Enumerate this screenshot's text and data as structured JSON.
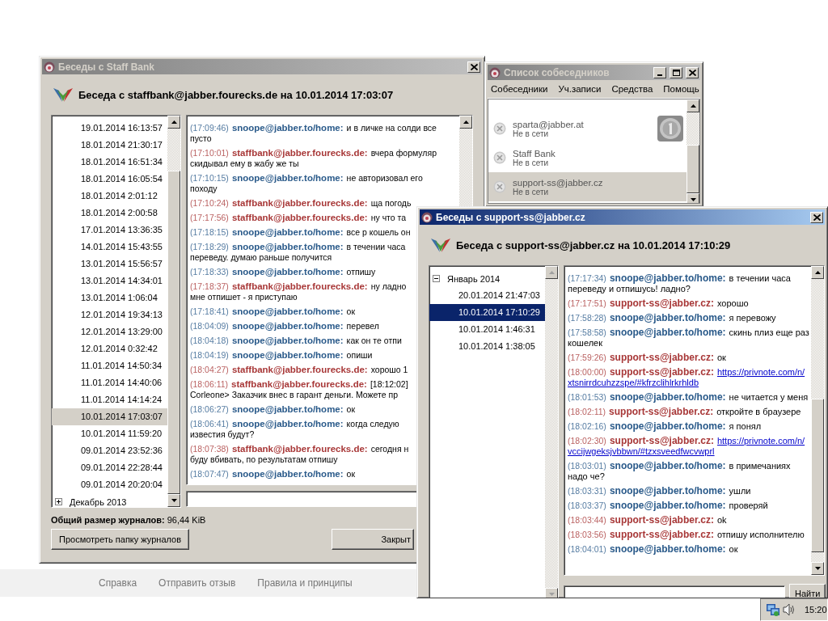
{
  "windows": [
    {
      "kind": "history",
      "title": "Беседы с Staff Bank",
      "active": false,
      "header": "Беседа с staffbank@jabber.fourecks.de на 10.01.2014 17:03:07",
      "tree": [
        {
          "children": [
            {
              "label": "19.01.2014 16:13:57",
              "selected": false
            },
            {
              "label": "18.01.2014 21:30:17",
              "selected": false
            },
            {
              "label": "18.01.2014 16:51:34",
              "selected": false
            },
            {
              "label": "18.01.2014 16:05:54",
              "selected": false
            },
            {
              "label": "18.01.2014 2:01:12",
              "selected": false
            },
            {
              "label": "18.01.2014 2:00:58",
              "selected": false
            },
            {
              "label": "17.01.2014 13:36:35",
              "selected": false
            },
            {
              "label": "14.01.2014 15:43:55",
              "selected": false
            },
            {
              "label": "13.01.2014 15:56:57",
              "selected": false
            },
            {
              "label": "13.01.2014 14:34:01",
              "selected": false
            },
            {
              "label": "13.01.2014 1:06:04",
              "selected": false
            },
            {
              "label": "12.01.2014 19:34:13",
              "selected": false
            },
            {
              "label": "12.01.2014 13:29:00",
              "selected": false
            },
            {
              "label": "12.01.2014 0:32:42",
              "selected": false
            },
            {
              "label": "11.01.2014 14:50:34",
              "selected": false
            },
            {
              "label": "11.01.2014 14:40:06",
              "selected": false
            },
            {
              "label": "11.01.2014 14:14:24",
              "selected": false
            },
            {
              "label": "10.01.2014 17:03:07",
              "selected": true
            },
            {
              "label": "10.01.2014 11:59:20",
              "selected": false
            },
            {
              "label": "09.01.2014 23:52:36",
              "selected": false
            },
            {
              "label": "09.01.2014 22:28:44",
              "selected": false
            },
            {
              "label": "09.01.2014 20:20:04",
              "selected": false
            }
          ]
        },
        {
          "label": "Декабрь 2013",
          "expanded": false
        }
      ],
      "messages": [
        {
          "time": "(17:09:46)",
          "sender": "snoope@jabber.to/home:",
          "color": "#2a5a8a",
          "kind": "text",
          "text": "и в личке на солди все",
          "line_2": "пусто"
        },
        {
          "time": "(17:10:01)",
          "sender": "staffbank@jabber.fourecks.de:",
          "color": "#a83838",
          "kind": "text",
          "text": "вчера формуляр",
          "line_2": "скидывал ему в жабу же ты"
        },
        {
          "time": "(17:10:15)",
          "sender": "snoope@jabber.to/home:",
          "color": "#2a5a8a",
          "kind": "text",
          "text": "не авторизовал его",
          "line_2": "походу"
        },
        {
          "time": "(17:10:24)",
          "sender": "staffbank@jabber.fourecks.de:",
          "color": "#a83838",
          "kind": "text",
          "text": "ща погодь"
        },
        {
          "time": "(17:17:56)",
          "sender": "staffbank@jabber.fourecks.de:",
          "color": "#a83838",
          "kind": "text",
          "text": "ну что та"
        },
        {
          "time": "(17:18:15)",
          "sender": "snoope@jabber.to/home:",
          "color": "#2a5a8a",
          "kind": "text",
          "text": "все р кошель он"
        },
        {
          "time": "(17:18:29)",
          "sender": "snoope@jabber.to/home:",
          "color": "#2a5a8a",
          "kind": "text",
          "text": "в течении часа",
          "line_2": "переведу. думаю раньше получится"
        },
        {
          "time": "(17:18:33)",
          "sender": "snoope@jabber.to/home:",
          "color": "#2a5a8a",
          "kind": "text",
          "text": "отпишу"
        },
        {
          "time": "(17:18:37)",
          "sender": "staffbank@jabber.fourecks.de:",
          "color": "#a83838",
          "kind": "text",
          "text": "ну ладно",
          "line_2": "мне отпишет - я приступаю"
        },
        {
          "time": "(17:18:41)",
          "sender": "snoope@jabber.to/home:",
          "color": "#2a5a8a",
          "kind": "text",
          "text": "ок"
        },
        {
          "time": "(18:04:09)",
          "sender": "snoope@jabber.to/home:",
          "color": "#2a5a8a",
          "kind": "text",
          "text": "перевел"
        },
        {
          "time": "(18:04:18)",
          "sender": "snoope@jabber.to/home:",
          "color": "#2a5a8a",
          "kind": "text",
          "text": "как он те отпи"
        },
        {
          "time": "(18:04:19)",
          "sender": "snoope@jabber.to/home:",
          "color": "#2a5a8a",
          "kind": "text",
          "text": "опиши"
        },
        {
          "time": "(18:04:27)",
          "sender": "staffbank@jabber.fourecks.de:",
          "color": "#a83838",
          "kind": "text",
          "text": "хорошо 1"
        },
        {
          "time": "(18:06:11)",
          "sender": "staffbank@jabber.fourecks.de:",
          "color": "#a83838",
          "kind": "text",
          "text": "[18:12:02]",
          "line_2": "Corleone> Заказчик внес в гарант деньги. Можете пр"
        },
        {
          "time": "(18:06:27)",
          "sender": "snoope@jabber.to/home:",
          "color": "#2a5a8a",
          "kind": "text",
          "text": "ок"
        },
        {
          "time": "(18:06:41)",
          "sender": "snoope@jabber.to/home:",
          "color": "#2a5a8a",
          "kind": "text",
          "text": "когда следую",
          "line_2": "известия будут?"
        },
        {
          "time": "(18:07:38)",
          "sender": "staffbank@jabber.fourecks.de:",
          "color": "#a83838",
          "kind": "text",
          "text": "сегодня н",
          "line_2": "буду вбивать, по результатам отпишу"
        },
        {
          "time": "(18:07:47)",
          "sender": "snoope@jabber.to/home:",
          "color": "#2a5a8a",
          "kind": "text",
          "text": "ок"
        }
      ],
      "total_size": "**Общий размер журналов:** 96,44 KiB",
      "buttons": [
        "Просмотреть папку журналов",
        "Закрыт"
      ]
    },
    {
      "kind": "roster",
      "title": "Список собеседников",
      "active": false,
      "menu": [
        "Собеседники",
        "Уч.записи",
        "Средства",
        "Помощь"
      ],
      "contacts": [
        {
          "name": "sparta@jabber.at",
          "status": "Не в сети",
          "has_avatar": true,
          "selected": false
        },
        {
          "name": "Staff Bank",
          "status": "Не в сети",
          "has_avatar": false,
          "selected": false
        },
        {
          "name": "support-ss@jabber.cz",
          "status": "Не в сети",
          "has_avatar": false,
          "selected": true
        }
      ]
    },
    {
      "kind": "history",
      "title": "Беседы с support-ss@jabber.cz",
      "active": true,
      "header": "Беседа с support-ss@jabber.cz на 10.01.2014 17:10:29",
      "tree": [
        {
          "label": "Январь 2014",
          "expanded": true,
          "children": [
            {
              "label": "20.01.2014 21:47:03",
              "selected": false
            },
            {
              "label": "10.01.2014 17:10:29",
              "selected": true
            },
            {
              "label": "10.01.2014 1:46:31",
              "selected": false
            },
            {
              "label": "10.01.2014 1:38:05",
              "selected": false
            }
          ]
        }
      ],
      "messages": [
        {
          "time": "(17:17:34)",
          "sender": "snoope@jabber.to/home:",
          "color": "#2a5a8a",
          "kind": "text",
          "text": "в течении часа",
          "line_2": "переведу и отпишусь! ладно?"
        },
        {
          "time": "(17:17:51)",
          "sender": "support-ss@jabber.cz:",
          "color": "#a83838",
          "kind": "text",
          "text": "хорошо"
        },
        {
          "time": "(17:58:28)",
          "sender": "snoope@jabber.to/home:",
          "color": "#2a5a8a",
          "kind": "text",
          "text": "я перевожу"
        },
        {
          "time": "(17:58:58)",
          "sender": "snoope@jabber.to/home:",
          "color": "#2a5a8a",
          "kind": "text",
          "text": "скинь плиз еще раз",
          "line_2": "кошелек"
        },
        {
          "time": "(17:59:26)",
          "sender": "support-ss@jabber.cz:",
          "color": "#a83838",
          "kind": "text",
          "text": "ок"
        },
        {
          "time": "(18:00:00)",
          "sender": "support-ss@jabber.cz:",
          "color": "#a83838",
          "kind": "link",
          "text": "https://privnote.com/n/",
          "line_2": "xtsnirrdcuhzzspe/#kfrzclihlrkrhldb"
        },
        {
          "time": "(18:01:53)",
          "sender": "snoope@jabber.to/home:",
          "color": "#2a5a8a",
          "kind": "text",
          "text": "не читается у меня"
        },
        {
          "time": "(18:02:11)",
          "sender": "support-ss@jabber.cz:",
          "color": "#a83838",
          "kind": "text",
          "text": "откройте в браузере"
        },
        {
          "time": "(18:02:16)",
          "sender": "snoope@jabber.to/home:",
          "color": "#2a5a8a",
          "kind": "text",
          "text": "я понял"
        },
        {
          "time": "(18:02:30)",
          "sender": "support-ss@jabber.cz:",
          "color": "#a83838",
          "kind": "link",
          "text": "https://privnote.com/n/",
          "line_2": "vccijwgeksjvbbwn/#tzxsveedfwcvwprl"
        },
        {
          "time": "(18:03:01)",
          "sender": "snoope@jabber.to/home:",
          "color": "#2a5a8a",
          "kind": "text",
          "text": "в примечаниях",
          "line_2": "надо че?"
        },
        {
          "time": "(18:03:31)",
          "sender": "snoope@jabber.to/home:",
          "color": "#2a5a8a",
          "kind": "text",
          "text": "ушли"
        },
        {
          "time": "(18:03:37)",
          "sender": "snoope@jabber.to/home:",
          "color": "#2a5a8a",
          "kind": "text",
          "text": "проверяй"
        },
        {
          "time": "(18:03:44)",
          "sender": "support-ss@jabber.cz:",
          "color": "#a83838",
          "kind": "text",
          "text": "ok"
        },
        {
          "time": "(18:03:56)",
          "sender": "support-ss@jabber.cz:",
          "color": "#a83838",
          "kind": "text",
          "text": "отпишу исполнителю"
        },
        {
          "time": "(18:04:01)",
          "sender": "snoope@jabber.to/home:",
          "color": "#2a5a8a",
          "kind": "text",
          "text": "ок"
        }
      ],
      "search_button": "Найти"
    }
  ],
  "footer_links": [
    "Справка",
    "Отправить отзыв",
    "Правила и принципы"
  ],
  "tray": {
    "clock": "15:20"
  }
}
